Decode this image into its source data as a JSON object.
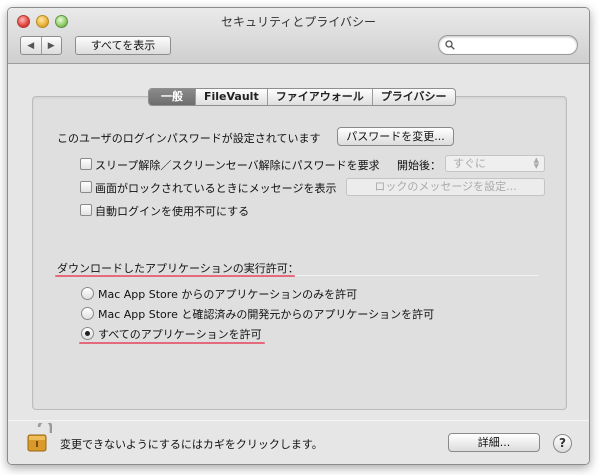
{
  "window": {
    "title": "セキュリティとプライバシー"
  },
  "toolbar": {
    "back_glyph": "◀",
    "forward_glyph": "▶",
    "show_all_label": "すべてを表示",
    "search_placeholder": ""
  },
  "tabs": [
    {
      "label": "一般",
      "active": true
    },
    {
      "label": "FileVault",
      "active": false
    },
    {
      "label": "ファイアウォール",
      "active": false
    },
    {
      "label": "プライバシー",
      "active": false
    }
  ],
  "general": {
    "password_status": "このユーザのログインパスワードが設定されています",
    "change_password_button": "パスワードを変更...",
    "require_password_label": "スリープ解除／スクリーンセーバ解除にパスワードを要求",
    "start_after_label": "開始後：",
    "start_after_value": "すぐに",
    "show_message_label": "画面がロックされているときにメッセージを表示",
    "set_lock_message_button": "ロックのメッセージを設定...",
    "disable_auto_login_label": "自動ログインを使用不可にする"
  },
  "downloads": {
    "heading": "ダウンロードしたアプリケーションの実行許可：",
    "options": [
      {
        "label": "Mac App Store からのアプリケーションのみを許可",
        "selected": false
      },
      {
        "label": "Mac App Store と確認済みの開発元からのアプリケーションを許可",
        "selected": false
      },
      {
        "label": "すべてのアプリケーションを許可",
        "selected": true
      }
    ]
  },
  "footer": {
    "lock_text": "変更できないようにするにはカギをクリックします。",
    "advanced_button": "詳細...",
    "help_glyph": "?"
  },
  "colors": {
    "annotation_underline": "#e8546a",
    "active_tab": "#7a7a7a"
  }
}
